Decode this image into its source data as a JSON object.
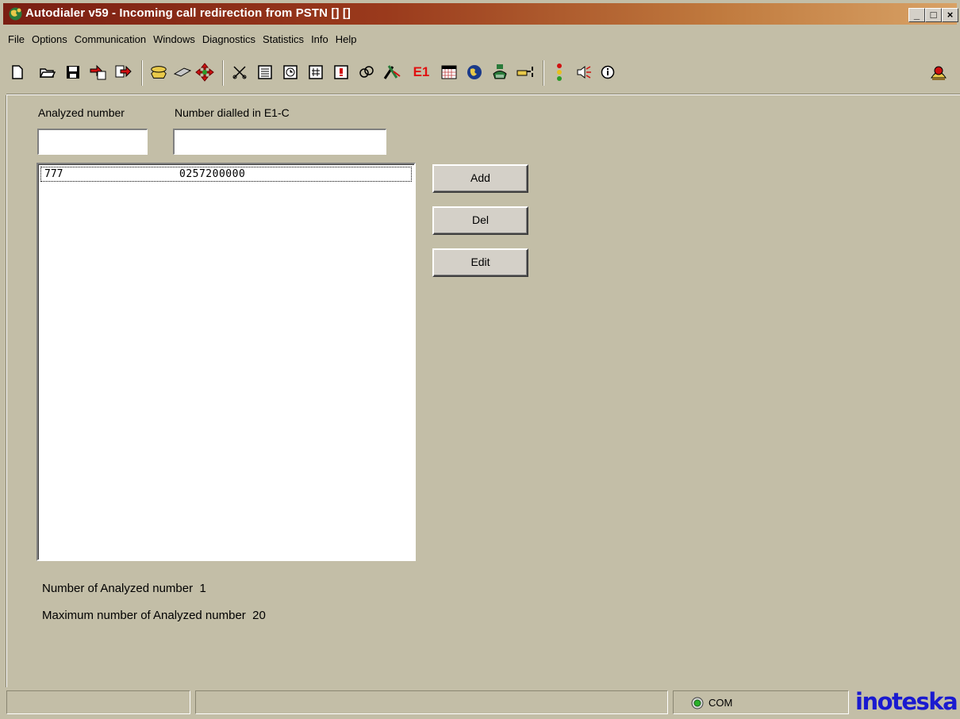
{
  "window": {
    "title": "Autodialer v59 - Incoming call redirection from PSTN [] []",
    "controls": {
      "minimize": "_",
      "maximize": "□",
      "close": "×"
    }
  },
  "menu": [
    {
      "label": "File"
    },
    {
      "label": "Options"
    },
    {
      "label": "Communication"
    },
    {
      "label": "Windows"
    },
    {
      "label": "Diagnostics"
    },
    {
      "label": "Statistics"
    },
    {
      "label": "Info"
    },
    {
      "label": "Help"
    }
  ],
  "toolbar": {
    "e1_label": "E1",
    "icons": [
      "new-document-icon",
      "open-folder-icon",
      "save-icon",
      "import-icon",
      "export-icon",
      "phone-icon",
      "chip-icon",
      "move-arrows-icon",
      "scissors-icon",
      "calendar-icon",
      "clock-icon",
      "hash-icon",
      "alert-doc-icon",
      "link-icon",
      "tools-icon",
      "e1-icon",
      "grid-icon",
      "globe-icon",
      "cli-phone-icon",
      "pointer-icon",
      "traffic-light-icon",
      "sound-icon",
      "info-icon",
      "help-icon"
    ]
  },
  "form": {
    "analyzed_label": "Analyzed number",
    "dialled_label": "Number dialled in E1-C",
    "analyzed_value": "",
    "dialled_value": ""
  },
  "list": {
    "rows": [
      {
        "analyzed": "777",
        "dialled": "0257200000"
      }
    ]
  },
  "buttons": {
    "add": "Add",
    "del": "Del",
    "edit": "Edit"
  },
  "info": {
    "count_label": "Number of Analyzed number",
    "count_value": "1",
    "max_label": "Maximum number of Analyzed number",
    "max_value": "20"
  },
  "status": {
    "com_label": "COM",
    "brand": "inoteska"
  },
  "colors": {
    "title_start": "#7a1e12",
    "title_end": "#d8a266",
    "brand": "#1a1ad0",
    "background": "#c3bea7"
  }
}
